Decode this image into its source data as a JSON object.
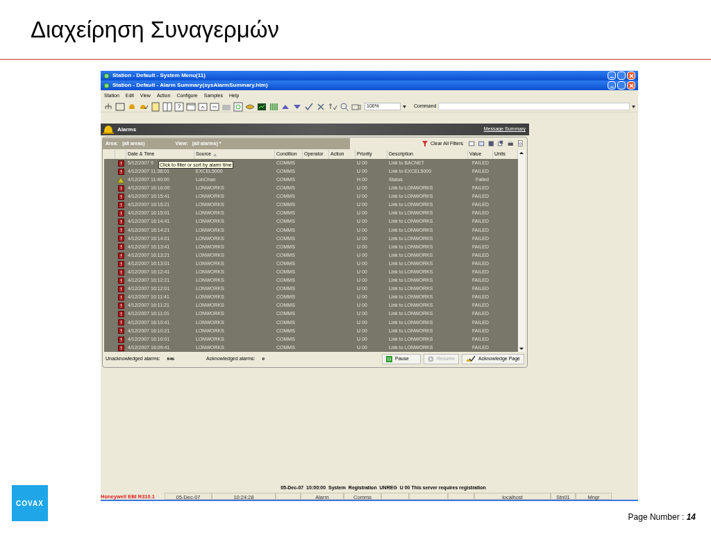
{
  "slide_title": "Διαχείρηση Συναγερμών",
  "windows": [
    {
      "title": "Station - Default - System Menu(11)"
    },
    {
      "title": "Station - Default - Alarm Summary(sysAlarmSummary.htm)"
    }
  ],
  "menu": [
    "Station",
    "Edit",
    "View",
    "Action",
    "Configure",
    "Samples",
    "Help"
  ],
  "toolbar": {
    "zoom": "100%",
    "command_label": "Command"
  },
  "alarms_panel": {
    "title": "Alarms",
    "link": "Message Summary",
    "area_label": "Area:",
    "area_value": "(all areas)",
    "view_label": "View:",
    "view_value": "(all alarms) *",
    "clear_filters": "Clear All Filters",
    "columns": [
      "Date & Time",
      "Source",
      "Condition",
      "Operator",
      "Action",
      "Priority",
      "Description",
      "Value",
      "Units"
    ],
    "tooltip": "Click to filter or sort by alarm time",
    "rows": [
      {
        "kind": "alarm",
        "date": "5/12/2007 9",
        "condition": "COMMS",
        "priority": "U 00",
        "description": "Link to BACNET",
        "value": "FAILED"
      },
      {
        "kind": "alarm",
        "date": "4/12/2007 11:38:01",
        "source": "EXCEL5000",
        "condition": "COMMS",
        "priority": "U 00",
        "description": "Link to EXCEL5000",
        "value": "FAILED"
      },
      {
        "kind": "warning",
        "date": "4/12/2007 11:40:00",
        "source": "LonChan",
        "condition": "COMMS",
        "priority": "H 00",
        "description": "Status",
        "value": "Failed"
      },
      {
        "kind": "alarm",
        "date": "4/12/2007 16:16:00",
        "source": "LONWORKS",
        "condition": "COMMS",
        "priority": "U 00",
        "description": "Link to LONWORKS",
        "value": "FAILED"
      },
      {
        "kind": "alarm",
        "date": "4/12/2007 16:15:41",
        "source": "LONWORKS",
        "condition": "COMMS",
        "priority": "U 00",
        "description": "Link to LONWORKS",
        "value": "FAILED"
      },
      {
        "kind": "alarm",
        "date": "4/12/2007 16:15:21",
        "source": "LONWORKS",
        "condition": "COMMS",
        "priority": "U 00",
        "description": "Link to LONWORKS",
        "value": "FAILED"
      },
      {
        "kind": "alarm",
        "date": "4/12/2007 16:15:01",
        "source": "LONWORKS",
        "condition": "COMMS",
        "priority": "U 00",
        "description": "Link to LONWORKS",
        "value": "FAILED"
      },
      {
        "kind": "alarm",
        "date": "4/12/2007 16:14:41",
        "source": "LONWORKS",
        "condition": "COMMS",
        "priority": "U 00",
        "description": "Link to LONWORKS",
        "value": "FAILED"
      },
      {
        "kind": "alarm",
        "date": "4/12/2007 16:14:21",
        "source": "LONWORKS",
        "condition": "COMMS",
        "priority": "U 00",
        "description": "Link to LONWORKS",
        "value": "FAILED"
      },
      {
        "kind": "alarm",
        "date": "4/12/2007 16:14:01",
        "source": "LONWORKS",
        "condition": "COMMS",
        "priority": "U 00",
        "description": "Link to LONWORKS",
        "value": "FAILED"
      },
      {
        "kind": "alarm",
        "date": "4/12/2007 16:13:41",
        "source": "LONWORKS",
        "condition": "COMMS",
        "priority": "U 00",
        "description": "Link to LONWORKS",
        "value": "FAILED"
      },
      {
        "kind": "alarm",
        "date": "4/12/2007 16:13:21",
        "source": "LONWORKS",
        "condition": "COMMS",
        "priority": "U 00",
        "description": "Link to LONWORKS",
        "value": "FAILED"
      },
      {
        "kind": "alarm",
        "date": "4/12/2007 16:13:01",
        "source": "LONWORKS",
        "condition": "COMMS",
        "priority": "U 00",
        "description": "Link to LONWORKS",
        "value": "FAILED"
      },
      {
        "kind": "alarm",
        "date": "4/12/2007 16:12:41",
        "source": "LONWORKS",
        "condition": "COMMS",
        "priority": "U 00",
        "description": "Link to LONWORKS",
        "value": "FAILED"
      },
      {
        "kind": "alarm",
        "date": "4/12/2007 16:12:21",
        "source": "LONWORKS",
        "condition": "COMMS",
        "priority": "U 00",
        "description": "Link to LONWORKS",
        "value": "FAILED"
      },
      {
        "kind": "alarm",
        "date": "4/12/2007 16:12:01",
        "source": "LONWORKS",
        "condition": "COMMS",
        "priority": "U 00",
        "description": "Link to LONWORKS",
        "value": "FAILED"
      },
      {
        "kind": "alarm",
        "date": "4/12/2007 16:11:41",
        "source": "LONWORKS",
        "condition": "COMMS",
        "priority": "U 00",
        "description": "Link to LONWORKS",
        "value": "FAILED"
      },
      {
        "kind": "alarm",
        "date": "4/12/2007 16:11:21",
        "source": "LONWORKS",
        "condition": "COMMS",
        "priority": "U 00",
        "description": "Link to LONWORKS",
        "value": "FAILED"
      },
      {
        "kind": "alarm",
        "date": "4/12/2007 16:11:01",
        "source": "LONWORKS",
        "condition": "COMMS",
        "priority": "U 00",
        "description": "Link to LONWORKS",
        "value": "FAILED"
      },
      {
        "kind": "alarm",
        "date": "4/12/2007 16:10:41",
        "source": "LONWORKS",
        "condition": "COMMS",
        "priority": "U 00",
        "description": "Link to LONWORKS",
        "value": "FAILED"
      },
      {
        "kind": "alarm",
        "date": "4/12/2007 16:10:21",
        "source": "LONWORKS",
        "condition": "COMMS",
        "priority": "U 00",
        "description": "Link to LONWORKS",
        "value": "FAILED"
      },
      {
        "kind": "alarm",
        "date": "4/12/2007 16:10:01",
        "source": "LONWORKS",
        "condition": "COMMS",
        "priority": "U 00",
        "description": "Link to LONWORKS",
        "value": "FAILED"
      },
      {
        "kind": "alarm",
        "date": "4/12/2007 16:09:41",
        "source": "LONWORKS",
        "condition": "COMMS",
        "priority": "U 00",
        "description": "Link to LONWORKS",
        "value": "FAILED"
      }
    ],
    "unack_label": "Unacknowledged alarms:",
    "unack_count": "846",
    "ack_label": "Acknowledged alarms:",
    "ack_count": "0",
    "buttons": [
      {
        "label": "Pause",
        "kind": "pause",
        "disabled": false
      },
      {
        "label": "Resume",
        "kind": "resume",
        "disabled": true
      },
      {
        "label": "Acknowledge Page",
        "kind": "ack",
        "disabled": false
      }
    ]
  },
  "message_line": "05-Dec-07  10:00:00  System  Registration  UNREG  U 00 This server requires registration",
  "status_cells": [
    {
      "kind": "product",
      "text": "Honeywell EBI R310.1"
    },
    {
      "kind": "text",
      "text": "05-Dec-07"
    },
    {
      "kind": "text",
      "text": "10:24:28"
    },
    {
      "kind": "blank"
    },
    {
      "kind": "text",
      "text": "Alarm"
    },
    {
      "kind": "text",
      "text": "Comms"
    },
    {
      "kind": "blank"
    },
    {
      "kind": "blank"
    },
    {
      "kind": "blank"
    },
    {
      "kind": "text",
      "text": "localhost"
    },
    {
      "kind": "text",
      "text": "Stn01"
    },
    {
      "kind": "text",
      "text": "Mngr"
    }
  ],
  "logo": "CΟVAX",
  "page_label": "Page Number : ",
  "page_number": "14"
}
